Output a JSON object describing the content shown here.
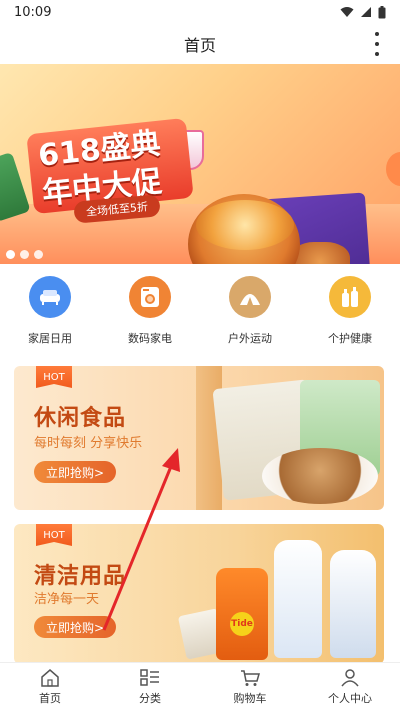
{
  "status_bar": {
    "time": "10:09",
    "icons": [
      "wifi-icon",
      "signal-icon",
      "battery-icon"
    ]
  },
  "header": {
    "title": "首页",
    "more_icon": "more-vertical-icon"
  },
  "banner": {
    "title_line1": "618盛典",
    "title_line2": "年中大促",
    "subtitle": "全场低至5折",
    "slide_count": 3,
    "active_slide": 1
  },
  "categories": [
    {
      "label": "家居日用",
      "icon": "sofa-icon",
      "color": "#4a8ef0"
    },
    {
      "label": "数码家电",
      "icon": "washer-icon",
      "color": "#f08434"
    },
    {
      "label": "户外运动",
      "icon": "tent-icon",
      "color": "#d9a86a"
    },
    {
      "label": "个护健康",
      "icon": "bottles-icon",
      "color": "#f5b93a"
    }
  ],
  "promos": [
    {
      "tag": "HOT",
      "title": "休闲食品",
      "subtitle": "每时每刻 分享快乐",
      "button": "立即抢购>"
    },
    {
      "tag": "HOT",
      "title": "清洁用品",
      "subtitle": "洁净每一天",
      "button": "立即抢购>"
    }
  ],
  "tabbar": [
    {
      "label": "首页",
      "icon": "home-icon"
    },
    {
      "label": "分类",
      "icon": "category-icon"
    },
    {
      "label": "购物车",
      "icon": "cart-icon"
    },
    {
      "label": "个人中心",
      "icon": "user-icon"
    }
  ],
  "accent": "#e5642a"
}
